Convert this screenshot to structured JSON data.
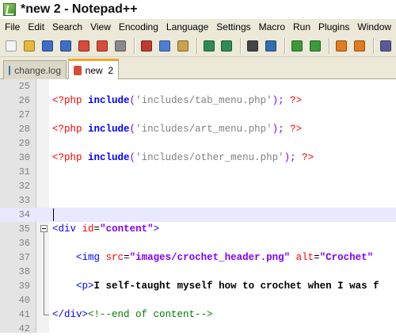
{
  "window": {
    "title": "*new  2 - Notepad++"
  },
  "menubar": {
    "items": [
      "File",
      "Edit",
      "Search",
      "View",
      "Encoding",
      "Language",
      "Settings",
      "Macro",
      "Run",
      "Plugins",
      "Window",
      "?"
    ]
  },
  "toolbar": {
    "buttons": [
      {
        "name": "new-file-icon",
        "color": "#f4f4f4"
      },
      {
        "name": "open-file-icon",
        "color": "#e8b83a"
      },
      {
        "name": "save-icon",
        "color": "#3c6ec8"
      },
      {
        "name": "save-all-icon",
        "color": "#3c6ec8"
      },
      {
        "name": "close-icon",
        "color": "#d84a3a"
      },
      {
        "name": "close-all-icon",
        "color": "#d84a3a"
      },
      {
        "name": "print-icon",
        "color": "#8a8a8a"
      },
      {
        "name": "cut-icon",
        "color": "#c0392b"
      },
      {
        "name": "copy-icon",
        "color": "#4a7fd4"
      },
      {
        "name": "paste-icon",
        "color": "#c9a24a"
      },
      {
        "name": "undo-icon",
        "color": "#2e8b57"
      },
      {
        "name": "redo-icon",
        "color": "#2e8b57"
      },
      {
        "name": "find-icon",
        "color": "#444444"
      },
      {
        "name": "replace-icon",
        "color": "#2f6fb0"
      },
      {
        "name": "zoom-in-icon",
        "color": "#3b9a3b"
      },
      {
        "name": "zoom-out-icon",
        "color": "#3b9a3b"
      },
      {
        "name": "sync-v-icon",
        "color": "#e07b1f"
      },
      {
        "name": "sync-h-icon",
        "color": "#e07b1f"
      },
      {
        "name": "wrap-icon",
        "color": "#5a5a9a"
      }
    ]
  },
  "tabs": [
    {
      "label": "change.log",
      "active": false,
      "icon_color": "#3c6ec8"
    },
    {
      "label": "new  2",
      "active": true,
      "icon_color": "#d84a3a"
    }
  ],
  "editor": {
    "lines": [
      {
        "n": "25",
        "code": ""
      },
      {
        "n": "26",
        "code": "<?php include('includes/tab_menu.php'); ?>"
      },
      {
        "n": "27",
        "code": ""
      },
      {
        "n": "28",
        "code": "<?php include('includes/art_menu.php'); ?>"
      },
      {
        "n": "29",
        "code": ""
      },
      {
        "n": "30",
        "code": "<?php include('includes/other_menu.php'); ?>"
      },
      {
        "n": "31",
        "code": ""
      },
      {
        "n": "32",
        "code": ""
      },
      {
        "n": "33",
        "code": ""
      },
      {
        "n": "34",
        "code": ""
      },
      {
        "n": "35",
        "code": "<div id=\"content\">"
      },
      {
        "n": "36",
        "code": ""
      },
      {
        "n": "37",
        "code": "    <img src=\"images/crochet_header.png\" alt=\"Crochet\""
      },
      {
        "n": "38",
        "code": ""
      },
      {
        "n": "39",
        "code": "    <p>I self-taught myself how to crochet when I was f"
      },
      {
        "n": "40",
        "code": ""
      },
      {
        "n": "41",
        "code": "</div><!--end of content-->"
      },
      {
        "n": "42",
        "code": ""
      }
    ],
    "current_line": "34"
  }
}
